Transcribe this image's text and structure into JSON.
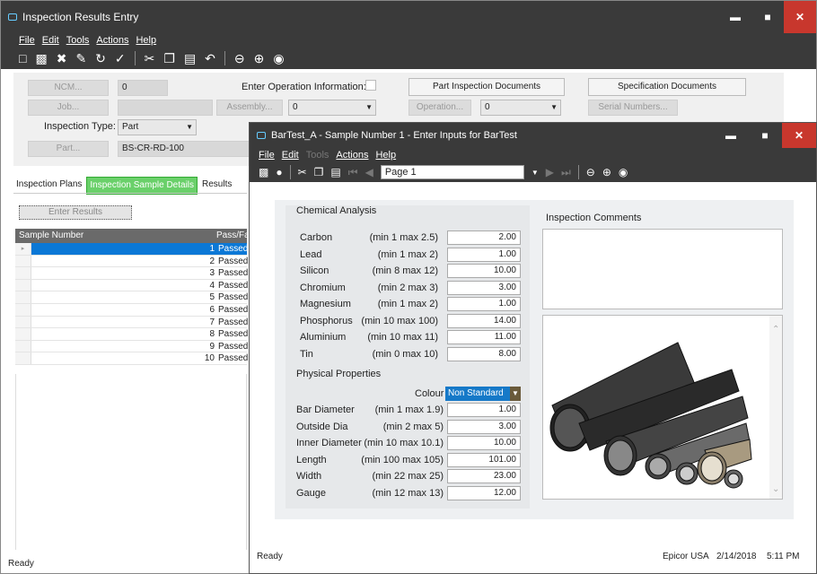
{
  "main": {
    "title": "Inspection Results Entry",
    "menu": [
      "File",
      "Edit",
      "Tools",
      "Actions",
      "Help"
    ],
    "form": {
      "ncm_label": "NCM...",
      "ncm_value": "0",
      "job_label": "Job...",
      "inspection_type_label": "Inspection Type:",
      "inspection_type_value": "Part",
      "part_label": "Part...",
      "part_value": "BS-CR-RD-100",
      "enter_operation_label": "Enter Operation Information:",
      "assembly_label": "Assembly...",
      "assembly_value": "0",
      "operation_label": "Operation...",
      "operation_value": "0",
      "part_inspection_docs": "Part Inspection Documents",
      "specification_docs": "Specification Documents",
      "serial_numbers": "Serial Numbers..."
    },
    "tabs": [
      "Inspection Plans",
      "Inspection Sample Details",
      "Results"
    ],
    "enter_results": "Enter Results",
    "grid": {
      "headers": [
        "Sample Number",
        "Pass/Fail"
      ],
      "rows": [
        {
          "num": "1",
          "status": "Passed"
        },
        {
          "num": "2",
          "status": "Passed"
        },
        {
          "num": "3",
          "status": "Passed"
        },
        {
          "num": "4",
          "status": "Passed"
        },
        {
          "num": "5",
          "status": "Passed"
        },
        {
          "num": "6",
          "status": "Passed"
        },
        {
          "num": "7",
          "status": "Passed"
        },
        {
          "num": "8",
          "status": "Passed"
        },
        {
          "num": "9",
          "status": "Passed"
        },
        {
          "num": "10",
          "status": "Passed"
        }
      ]
    },
    "status": "Ready"
  },
  "dialog": {
    "title": "BarTest_A - Sample Number 1 - Enter Inputs for BarTest",
    "menu": [
      "File",
      "Edit",
      "Tools",
      "Actions",
      "Help"
    ],
    "page": "Page 1",
    "chemical_title": "Chemical Analysis",
    "chemical": [
      {
        "name": "Carbon",
        "range": "(min 1 max 2.5)",
        "value": "2.00"
      },
      {
        "name": "Lead",
        "range": "(min 1 max 2)",
        "value": "1.00"
      },
      {
        "name": "Silicon",
        "range": "(min 8 max 12)",
        "value": "10.00"
      },
      {
        "name": "Chromium",
        "range": "(min 2 max 3)",
        "value": "3.00"
      },
      {
        "name": "Magnesium",
        "range": "(min 1 max 2)",
        "value": "1.00"
      },
      {
        "name": "Phosphorus",
        "range": "(min 10 max 100)",
        "value": "14.00"
      },
      {
        "name": "Aluminium",
        "range": "(min 10 max 11)",
        "value": "11.00"
      },
      {
        "name": "Tin",
        "range": "(min 0 max 10)",
        "value": "8.00"
      }
    ],
    "physical_title": "Physical Properties",
    "colour_label": "Colour",
    "colour_value": "Non Standard",
    "physical": [
      {
        "name": "Bar Diameter",
        "range": "(min 1 max 1.9)",
        "value": "1.00"
      },
      {
        "name": "Outside Dia",
        "range": "(min 2 max 5)",
        "value": "3.00"
      },
      {
        "name": "Inner Diameter",
        "range": "(min 10 max 10.1)",
        "value": "10.00"
      },
      {
        "name": "Length",
        "range": "(min 100 max 105)",
        "value": "101.00"
      },
      {
        "name": "Width",
        "range": "(min 22 max 25)",
        "value": "23.00"
      },
      {
        "name": "Gauge",
        "range": "(min 12 max 13)",
        "value": "12.00"
      }
    ],
    "comments_title": "Inspection Comments",
    "status": "Ready",
    "company": "Epicor USA",
    "date": "2/14/2018",
    "time": "5:11 PM"
  },
  "colors": {
    "accent_selected": "#0b78d6",
    "tab_active": "#6ad06a",
    "titlebar": "#3a3a3a",
    "close": "#c8372d"
  }
}
